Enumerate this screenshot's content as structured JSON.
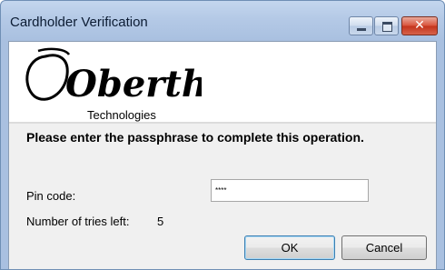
{
  "window": {
    "title": "Cardholder Verification"
  },
  "caption_buttons": {
    "minimize": "minimize-icon",
    "maximize": "maximize-icon",
    "close": "close-icon"
  },
  "logo": {
    "brand": "Oberthur",
    "subtitle": "Technologies"
  },
  "prompt": {
    "text": "Please enter the passphrase to complete this operation."
  },
  "pin": {
    "label": "Pin code:",
    "value": "****"
  },
  "tries": {
    "label": "Number of tries left:",
    "value": "5"
  },
  "buttons": {
    "ok": "OK",
    "cancel": "Cancel"
  },
  "colors": {
    "titlebar": "#b4c9e6",
    "close_button": "#d9553d",
    "client_background": "#f0f0f0"
  }
}
